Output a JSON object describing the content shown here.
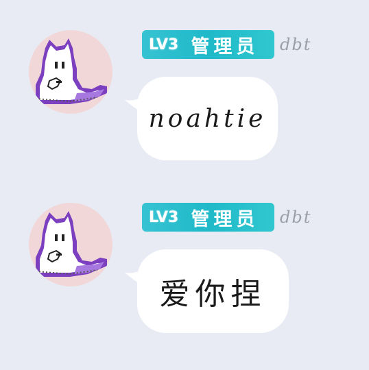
{
  "messages": [
    {
      "badge_level": "LV3",
      "badge_role": "管理员",
      "username": "dbt",
      "text": "noahtie"
    },
    {
      "badge_level": "LV3",
      "badge_role": "管理员",
      "username": "dbt",
      "text": "爱你捏"
    }
  ],
  "colors": {
    "background": "#e8ebf4",
    "badge": "#1fb9c9",
    "bubble": "#ffffff",
    "avatar_bg": "#f1d7d8",
    "avatar_outline": "#7b3fbf"
  },
  "icons": {
    "avatar": "pixel-cat-avatar"
  }
}
